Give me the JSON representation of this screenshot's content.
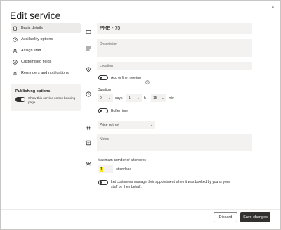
{
  "dialog": {
    "title": "Edit service",
    "close_glyph": "×"
  },
  "sidebar": {
    "items": [
      {
        "label": "Basic details",
        "icon": "clipboard-icon",
        "active": true
      },
      {
        "label": "Availability options",
        "icon": "clock-icon",
        "active": false
      },
      {
        "label": "Assign staff",
        "icon": "person-icon",
        "active": false
      },
      {
        "label": "Customised fields",
        "icon": "check-circle-icon",
        "active": false
      },
      {
        "label": "Reminders and notifications",
        "icon": "bell-icon",
        "active": false
      }
    ],
    "publishing": {
      "title": "Publishing options",
      "toggle_label": "Show this service on the booking page",
      "enabled": true
    }
  },
  "form": {
    "name": "PME - 75",
    "description_placeholder": "Description",
    "location_placeholder": "Location",
    "online_meeting_label": "Add online meeting",
    "online_meeting_enabled": false,
    "duration": {
      "label": "Duration",
      "days": "0",
      "days_label": "days",
      "hours": "1",
      "hours_label": "h",
      "minutes": "15",
      "minutes_label": "min"
    },
    "buffer_label": "Buffer time",
    "buffer_enabled": false,
    "price": "Price not set",
    "notes_placeholder": "Notes",
    "attendees": {
      "label": "Maximum number of attendees",
      "value": "1",
      "unit": "attendees",
      "highlight_color": "#f8e71c"
    },
    "manage_label": "Let customers manage their appointment when it was booked by you or your staff on their behalf.",
    "manage_enabled": false
  },
  "footer": {
    "discard_label": "Discard",
    "save_label": "Save changes"
  }
}
